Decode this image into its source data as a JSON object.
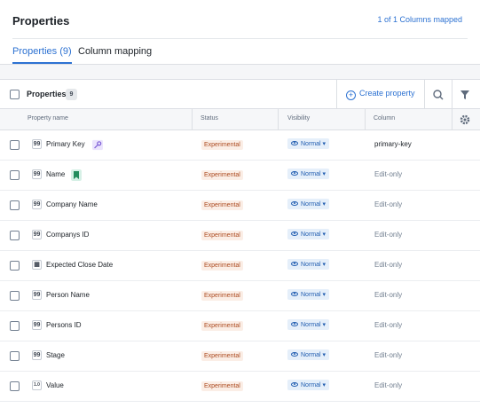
{
  "header": {
    "title": "Properties",
    "mapped_text": "1 of 1 Columns mapped"
  },
  "tabs": [
    {
      "label": "Properties (9)",
      "active": true
    },
    {
      "label": "Column mapping",
      "active": false
    }
  ],
  "toolbar": {
    "label": "Properties",
    "count": "9",
    "create_label": "Create property",
    "icons": [
      "search-icon",
      "filter-icon"
    ]
  },
  "columns": {
    "property_name": "Property name",
    "status": "Status",
    "visibility": "Visibility",
    "column": "Column",
    "settings_icon": "gear-icon"
  },
  "rows": [
    {
      "type_icon": "99",
      "name": "Primary Key",
      "status": "Experimental",
      "visibility": "Normal",
      "column": "primary-key",
      "badge": "key-icon"
    },
    {
      "type_icon": "99",
      "name": "Name",
      "status": "Experimental",
      "visibility": "Normal",
      "column": "Edit-only",
      "badge": "bookmark-icon"
    },
    {
      "type_icon": "99",
      "name": "Company Name",
      "status": "Experimental",
      "visibility": "Normal",
      "column": "Edit-only"
    },
    {
      "type_icon": "99",
      "name": "Companys ID",
      "status": "Experimental",
      "visibility": "Normal",
      "column": "Edit-only"
    },
    {
      "type_icon": "▦",
      "name": "Expected Close Date",
      "status": "Experimental",
      "visibility": "Normal",
      "column": "Edit-only"
    },
    {
      "type_icon": "99",
      "name": "Person Name",
      "status": "Experimental",
      "visibility": "Normal",
      "column": "Edit-only"
    },
    {
      "type_icon": "99",
      "name": "Persons ID",
      "status": "Experimental",
      "visibility": "Normal",
      "column": "Edit-only"
    },
    {
      "type_icon": "99",
      "name": "Stage",
      "status": "Experimental",
      "visibility": "Normal",
      "column": "Edit-only"
    },
    {
      "type_icon": "1.0",
      "name": "Value",
      "status": "Experimental",
      "visibility": "Normal",
      "column": "Edit-only"
    }
  ],
  "colors": {
    "accent": "#2d72d2",
    "status_bg": "#fbeee6",
    "status_text": "#ac4a1f",
    "key_badge": "#b9a6f3",
    "bookmark_badge": "#2aa67a"
  }
}
